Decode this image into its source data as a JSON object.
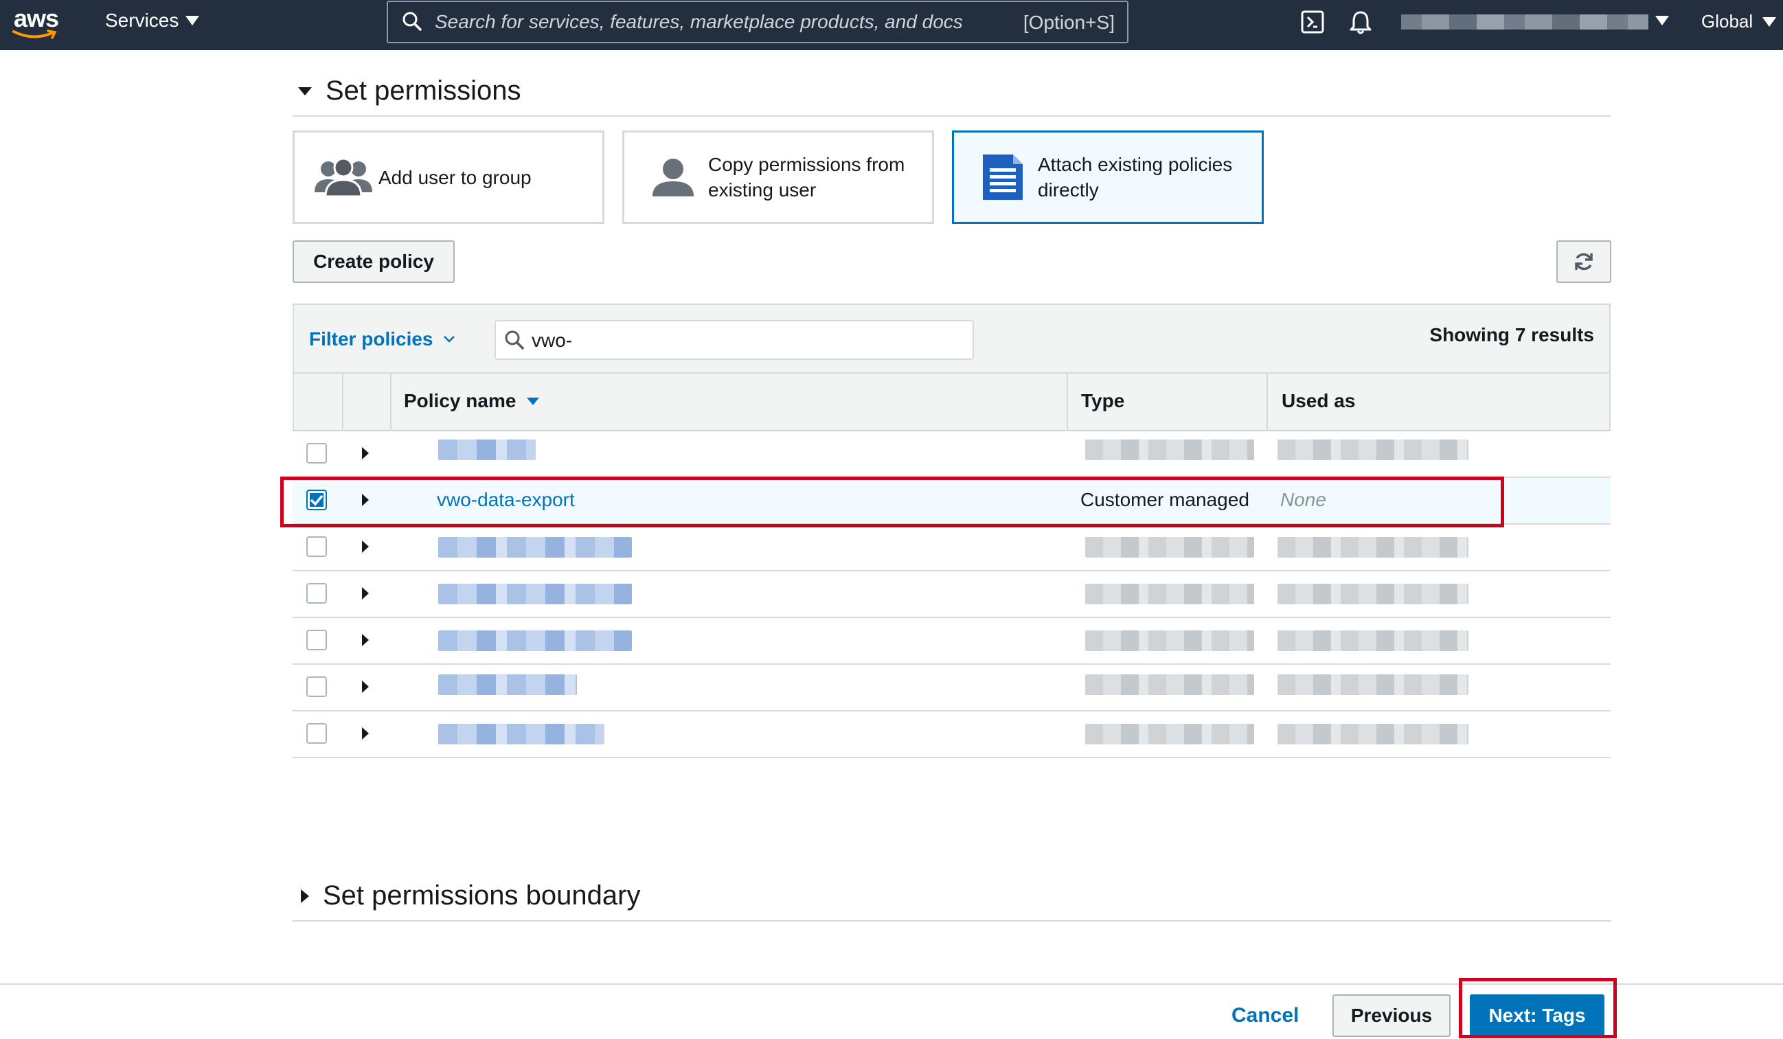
{
  "topnav": {
    "logo_text": "aws",
    "services_label": "Services",
    "search_placeholder": "Search for services, features, marketplace products, and docs",
    "search_shortcut": "[Option+S]",
    "region_label": "Global",
    "icons": [
      "cloudshell-icon",
      "bell-icon"
    ]
  },
  "permissions": {
    "title": "Set permissions",
    "options": [
      {
        "label": "Add user to group",
        "icon": "group-icon",
        "selected": false
      },
      {
        "label": "Copy permissions from existing user",
        "icon": "user-icon",
        "selected": false
      },
      {
        "label": "Attach existing policies directly",
        "icon": "document-icon",
        "selected": true
      }
    ],
    "create_policy_label": "Create policy",
    "refresh_icon": "refresh-icon"
  },
  "table": {
    "filter_label": "Filter policies",
    "filter_value": "vwo-",
    "result_count": "Showing 7 results",
    "columns": [
      "Policy name",
      "Type",
      "Used as"
    ],
    "rows": [
      {
        "name": "",
        "type": "",
        "used_as": "",
        "checked": false
      },
      {
        "name": "vwo-data-export",
        "type": "Customer managed",
        "used_as": "None",
        "checked": true
      },
      {
        "name": "",
        "type": "",
        "used_as": "",
        "checked": false
      },
      {
        "name": "",
        "type": "",
        "used_as": "",
        "checked": false
      },
      {
        "name": "",
        "type": "",
        "used_as": "",
        "checked": false
      },
      {
        "name": "",
        "type": "",
        "used_as": "",
        "checked": false
      },
      {
        "name": "",
        "type": "",
        "used_as": "",
        "checked": false
      }
    ]
  },
  "boundary": {
    "title": "Set permissions boundary"
  },
  "footer": {
    "cancel_label": "Cancel",
    "previous_label": "Previous",
    "next_label": "Next: Tags"
  },
  "colors": {
    "nav_bg": "#232f3e",
    "link_blue": "#0073bb",
    "highlight_red": "#d0021b",
    "selected_bg": "#f1faff"
  }
}
